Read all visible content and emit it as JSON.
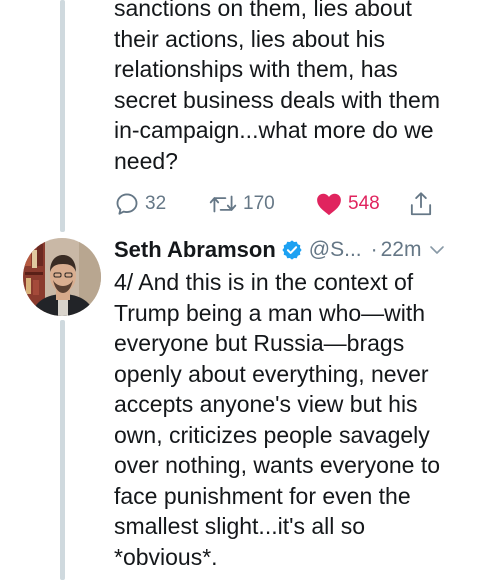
{
  "tweet1": {
    "text": "sanctions on them, lies about\ntheir actions, lies about his\nrelationships with them, has\nsecret business deals with them\nin-campaign...what more do we\nneed?",
    "actions": {
      "reply_count": "32",
      "retweet_count": "170",
      "like_count": "548"
    }
  },
  "tweet2": {
    "display_name": "Seth Abramson",
    "handle": "@S...",
    "separator": "·",
    "time": "22m",
    "text": "4/ And this is in the context of\nTrump being a man who—with\neveryone but Russia—brags\nopenly about everything, never\naccepts anyone's view but his\nown, criticizes people savagely\nover nothing, wants everyone to\nface punishment for even the\nsmallest slight...it's all so\n*obvious*."
  },
  "colors": {
    "text": "#14171a",
    "secondary": "#657786",
    "like": "#e0245e",
    "verified": "#1da1f2",
    "thread_line": "#cfd9de"
  },
  "icons": {
    "reply": "reply-bubble-icon",
    "retweet": "retweet-arrows-icon",
    "like": "heart-icon",
    "share": "share-upload-icon",
    "verified": "verified-badge-icon",
    "caret": "chevron-down-icon"
  }
}
